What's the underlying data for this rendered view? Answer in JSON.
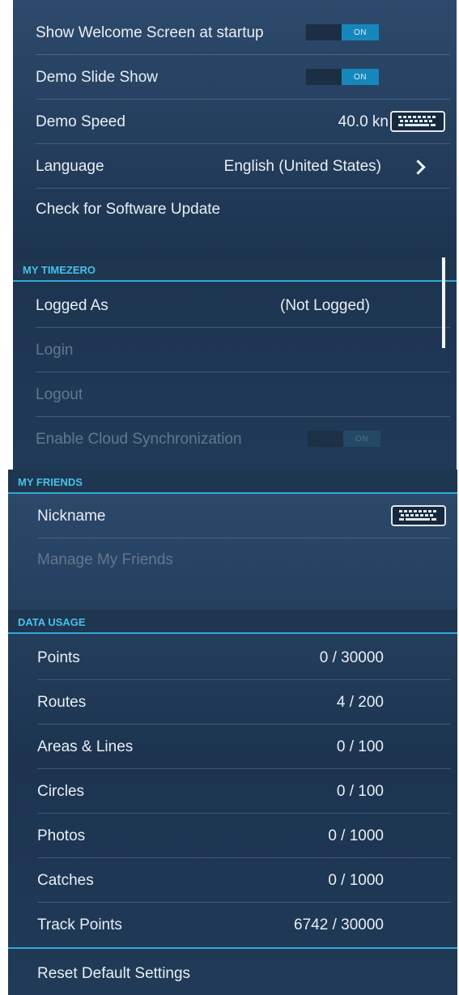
{
  "general": {
    "welcome_label": "Show Welcome Screen at startup",
    "welcome_toggle": "ON",
    "demo_slide_label": "Demo Slide Show",
    "demo_slide_toggle": "ON",
    "demo_speed_label": "Demo Speed",
    "demo_speed_value": "40.0 kn",
    "language_label": "Language",
    "language_value": "English (United States)",
    "update_label": "Check for Software Update"
  },
  "my_timezero": {
    "header": "MY TIMEZERO",
    "logged_as_label": "Logged As",
    "logged_as_value": "(Not Logged)",
    "login_label": "Login",
    "logout_label": "Logout",
    "cloud_sync_label": "Enable Cloud Synchronization",
    "cloud_sync_toggle": "ON"
  },
  "my_friends": {
    "header": "MY FRIENDS",
    "nickname_label": "Nickname",
    "manage_label": "Manage My Friends"
  },
  "data_usage": {
    "header": "DATA USAGE",
    "rows": [
      {
        "label": "Points",
        "value": "0 / 30000"
      },
      {
        "label": "Routes",
        "value": "4 / 200"
      },
      {
        "label": "Areas & Lines",
        "value": "0 / 100"
      },
      {
        "label": "Circles",
        "value": "0 / 100"
      },
      {
        "label": "Photos",
        "value": "0 / 1000"
      },
      {
        "label": "Catches",
        "value": "0 / 1000"
      },
      {
        "label": "Track Points",
        "value": "6742 / 30000"
      }
    ]
  },
  "reset_label": "Reset Default Settings",
  "icons": [
    "keyboard-icon",
    "chevron-right-icon"
  ],
  "colors": {
    "accent": "#30a9d8",
    "toggle_on": "#1687bd",
    "panel": "#23405f"
  }
}
